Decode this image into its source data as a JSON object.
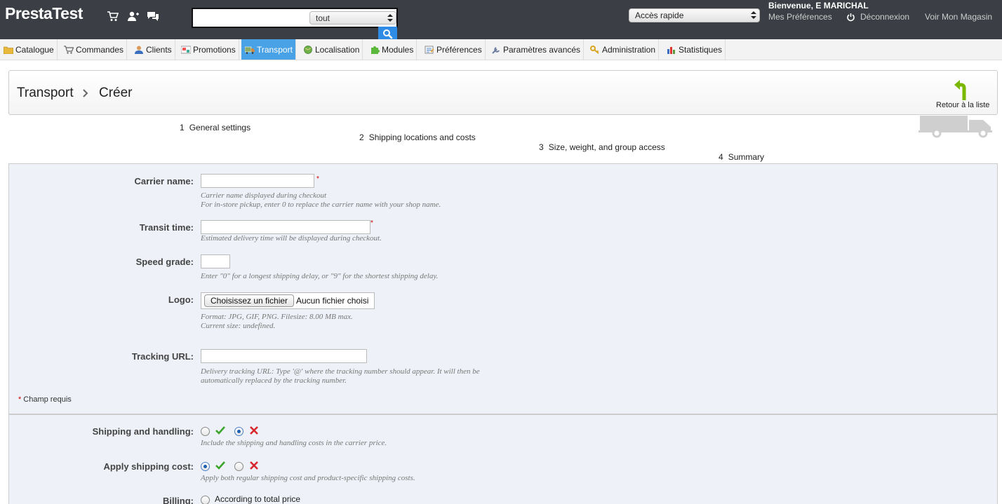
{
  "header": {
    "brand": "PrestaTest",
    "search": {
      "value": "",
      "scope": "tout"
    },
    "quick_access": "Accès rapide",
    "welcome": "Bienvenue, E MARICHAL",
    "links": {
      "preferences": "Mes Préférences",
      "logout": "Déconnexion",
      "shop": "Voir Mon Magasin"
    }
  },
  "nav": {
    "tabs": [
      {
        "label": "Catalogue",
        "icon": "folder-icon"
      },
      {
        "label": "Commandes",
        "icon": "cart-icon"
      },
      {
        "label": "Clients",
        "icon": "user-icon"
      },
      {
        "label": "Promotions",
        "icon": "promo-icon"
      },
      {
        "label": "Transport",
        "icon": "truck-icon",
        "active": true
      },
      {
        "label": "Localisation",
        "icon": "globe-icon"
      },
      {
        "label": "Modules",
        "icon": "puzzle-icon"
      },
      {
        "label": "Préférences",
        "icon": "settings-icon"
      },
      {
        "label": "Paramètres avancés",
        "icon": "wrench-icon"
      },
      {
        "label": "Administration",
        "icon": "key-icon"
      },
      {
        "label": "Statistiques",
        "icon": "chart-icon"
      }
    ]
  },
  "toolbar": {
    "crumb_section": "Transport",
    "crumb_page": "Créer",
    "back_label": "Retour à la liste"
  },
  "steps": [
    {
      "num": "1",
      "label": "General settings"
    },
    {
      "num": "2",
      "label": "Shipping locations and costs"
    },
    {
      "num": "3",
      "label": "Size, weight, and group access"
    },
    {
      "num": "4",
      "label": "Summary"
    }
  ],
  "form": {
    "carrier_name": {
      "label": "Carrier name:",
      "value": "",
      "hint1": "Carrier name displayed during checkout",
      "hint2": "For in-store pickup, enter 0 to replace the carrier name with your shop name."
    },
    "transit_time": {
      "label": "Transit time:",
      "value": "",
      "hint": "Estimated delivery time will be displayed during checkout."
    },
    "speed_grade": {
      "label": "Speed grade:",
      "value": "",
      "hint": "Enter \"0\" for a longest shipping delay, or \"9\" for the shortest shipping delay."
    },
    "logo": {
      "label": "Logo:",
      "button": "Choisissez un fichier",
      "state": "Aucun fichier choisi",
      "hint1": "Format: JPG, GIF, PNG. Filesize: 8.00 MB max.",
      "hint2": "Current size: undefined."
    },
    "tracking_url": {
      "label": "Tracking URL:",
      "value": "",
      "hint1": "Delivery tracking URL: Type '@' where the tracking number should appear. It will then be",
      "hint2": "automatically replaced by the tracking number."
    },
    "required_star": "*",
    "required_note": "Champ requis",
    "shipping_handling": {
      "label": "Shipping and handling:",
      "selected": "no",
      "hint": "Include the shipping and handling costs in the carrier price."
    },
    "apply_shipping_cost": {
      "label": "Apply shipping cost:",
      "selected": "yes",
      "hint": "Apply both regular shipping cost and product-specific shipping costs."
    },
    "billing": {
      "label": "Billing:",
      "option1": "According to total price"
    }
  },
  "colors": {
    "header_bg": "#3b3f45",
    "active_tab": "#49a2e6",
    "search_btn": "#2f8ce6",
    "yes_green": "#3aa52a",
    "no_red": "#d9272e"
  }
}
